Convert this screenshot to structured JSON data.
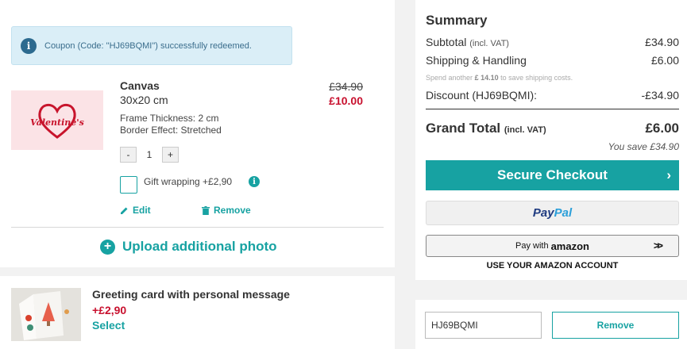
{
  "notice": {
    "message": "Coupon (Code: \"HJ69BQMI\") successfully redeemed.",
    "icon": "info-icon"
  },
  "product": {
    "thumbnail_text": "Valentine's",
    "name": "Canvas",
    "size": "30x20 cm",
    "frame": "Frame Thickness: 2 cm",
    "border": "Border Effect: Stretched",
    "old_price": "£34.90",
    "new_price": "£10.00",
    "quantity": "1",
    "qty_minus": "-",
    "qty_plus": "+",
    "gift_label": "Gift wrapping +£2,90",
    "edit": "Edit",
    "remove": "Remove"
  },
  "upload": {
    "label": "Upload additional photo"
  },
  "greeting_card": {
    "title": "Greeting card with personal message",
    "price": "+£2,90",
    "select": "Select"
  },
  "summary": {
    "title": "Summary",
    "subtotal_label": "Subtotal",
    "subtotal_note": "(incl. VAT)",
    "subtotal_value": "£34.90",
    "shipping_label": "Shipping & Handling",
    "shipping_value": "£6.00",
    "hint_prefix": "Spend another",
    "hint_amount": "£ 14.10",
    "hint_suffix": "to save shipping costs.",
    "discount_label": "Discount (HJ69BQMI):",
    "discount_value": "-£34.90",
    "grand_label": "Grand Total",
    "grand_note": "(incl. VAT)",
    "grand_value": "£6.00",
    "you_save": "You save £34.90",
    "checkout": "Secure Checkout",
    "paypal_a": "Pay",
    "paypal_b": "Pal",
    "amazon_prefix": "Pay with",
    "amazon_brand": "amazon",
    "amazon_note": "USE YOUR AMAZON ACCOUNT"
  },
  "coupon": {
    "value": "HJ69BQMI",
    "remove": "Remove"
  },
  "colors": {
    "accent": "#17a2a2",
    "price_red": "#c8102e",
    "notice_bg": "#daeef7"
  }
}
